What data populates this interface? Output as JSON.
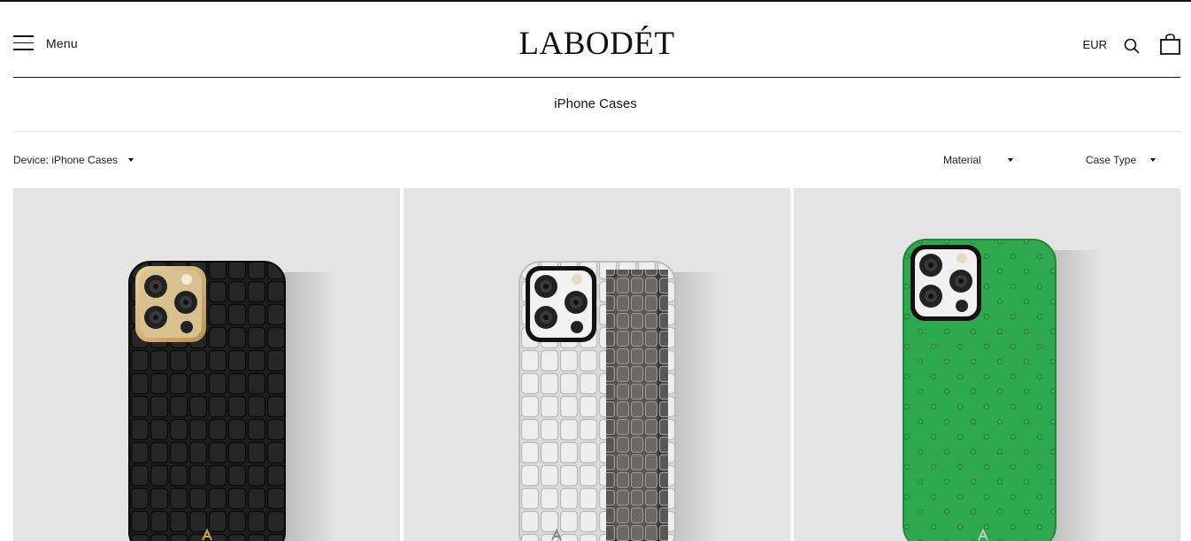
{
  "header": {
    "menu_label": "Menu",
    "logo": "LABODÉT",
    "currency": "EUR"
  },
  "page": {
    "title": "iPhone Cases"
  },
  "filters": {
    "device": "Device: iPhone Cases",
    "material": "Material",
    "case_type": "Case Type"
  },
  "products": [
    {
      "material": "black alligator",
      "camera_frame": "gold",
      "color": "#1c1c1c"
    },
    {
      "material": "white / grey alligator with strap",
      "camera_frame": "silver",
      "color": "#d9dada"
    },
    {
      "material": "green ostrich",
      "camera_frame": "silver",
      "color": "#2fa94e"
    }
  ],
  "colors": {
    "text": "#111111",
    "card_bg": "#e4e4e5",
    "rule": "#111111"
  }
}
